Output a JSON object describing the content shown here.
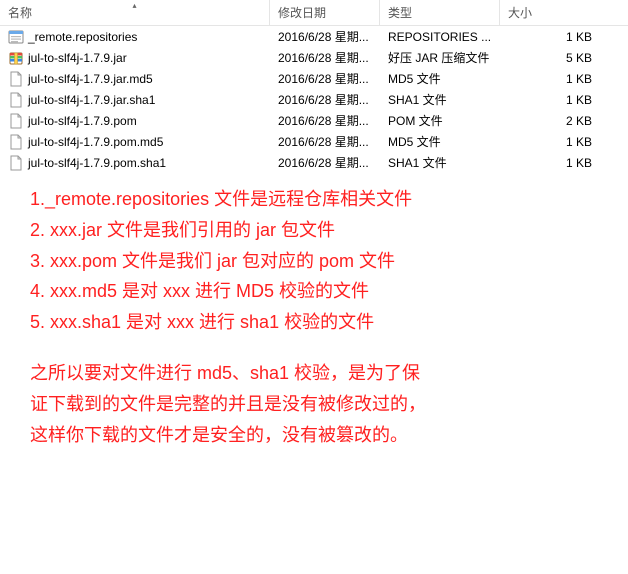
{
  "header": {
    "name": "名称",
    "date": "修改日期",
    "type": "类型",
    "size": "大小"
  },
  "rows": [
    {
      "icon": "repo",
      "name": "_remote.repositories",
      "date": "2016/6/28 星期...",
      "type": "REPOSITORIES ...",
      "size": "1 KB"
    },
    {
      "icon": "jar",
      "name": "jul-to-slf4j-1.7.9.jar",
      "date": "2016/6/28 星期...",
      "type": "好压 JAR 压缩文件",
      "size": "5 KB"
    },
    {
      "icon": "file",
      "name": "jul-to-slf4j-1.7.9.jar.md5",
      "date": "2016/6/28 星期...",
      "type": "MD5 文件",
      "size": "1 KB"
    },
    {
      "icon": "file",
      "name": "jul-to-slf4j-1.7.9.jar.sha1",
      "date": "2016/6/28 星期...",
      "type": "SHA1 文件",
      "size": "1 KB"
    },
    {
      "icon": "file",
      "name": "jul-to-slf4j-1.7.9.pom",
      "date": "2016/6/28 星期...",
      "type": "POM 文件",
      "size": "2 KB"
    },
    {
      "icon": "file",
      "name": "jul-to-slf4j-1.7.9.pom.md5",
      "date": "2016/6/28 星期...",
      "type": "MD5 文件",
      "size": "1 KB"
    },
    {
      "icon": "file",
      "name": "jul-to-slf4j-1.7.9.pom.sha1",
      "date": "2016/6/28 星期...",
      "type": "SHA1 文件",
      "size": "1 KB"
    }
  ],
  "annotations": {
    "l1": "1._remote.repositories 文件是远程仓库相关文件",
    "l2": "2. xxx.jar 文件是我们引用的 jar 包文件",
    "l3": "3. xxx.pom 文件是我们 jar 包对应的 pom 文件",
    "l4": "4. xxx.md5 是对 xxx 进行 MD5 校验的文件",
    "l5": "5. xxx.sha1 是对 xxx 进行 sha1 校验的文件",
    "p1": "之所以要对文件进行 md5、sha1 校验，是为了保",
    "p2": "证下载到的文件是完整的并且是没有被修改过的，",
    "p3": "这样你下载的文件才是安全的，没有被篡改的。"
  }
}
